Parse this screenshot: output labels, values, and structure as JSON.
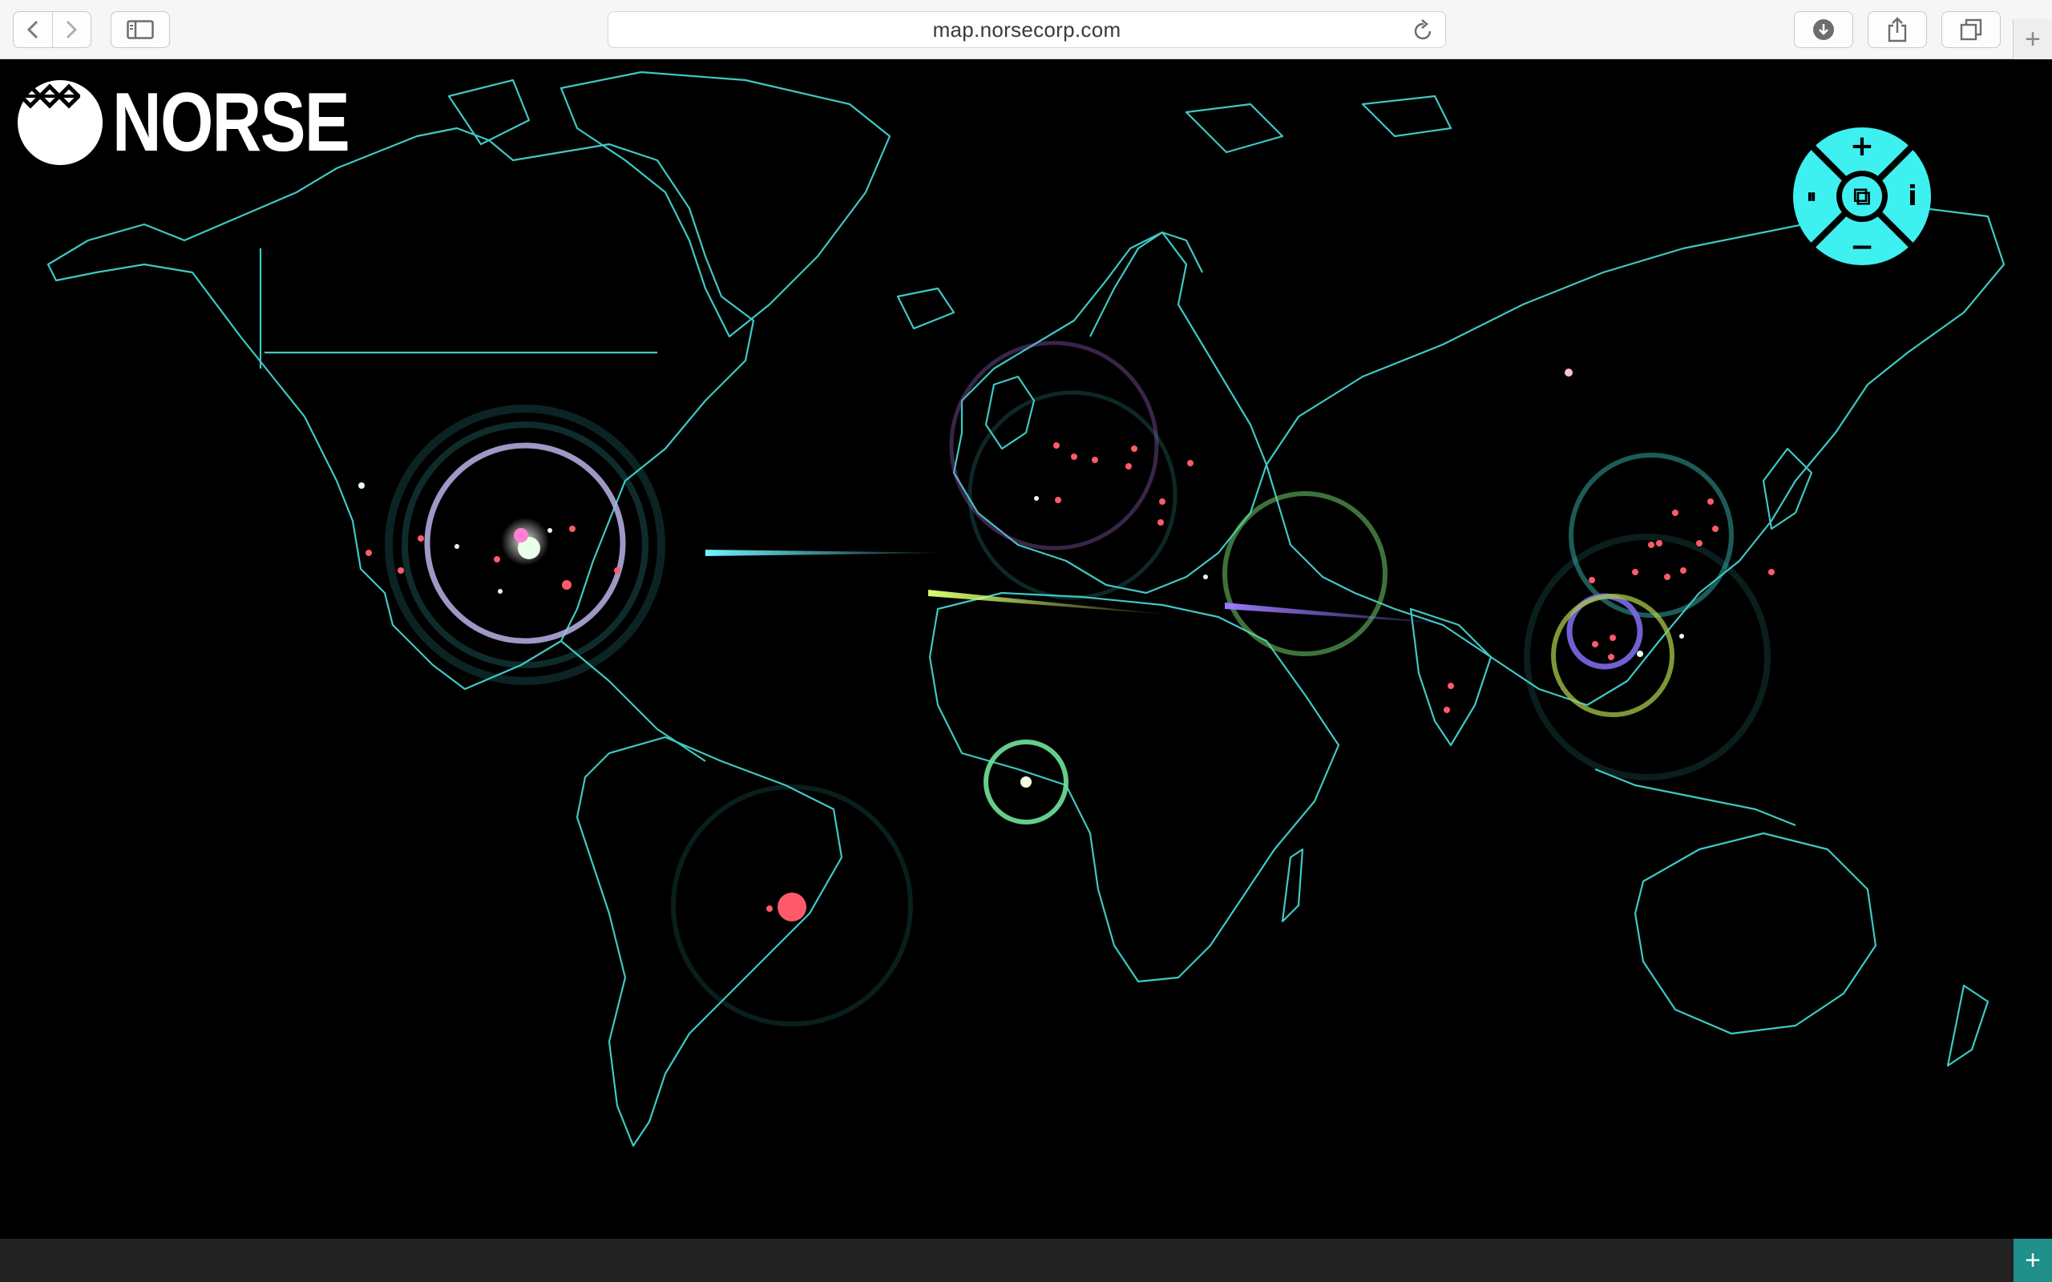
{
  "browser": {
    "url": "map.norsecorp.com",
    "icons": {
      "back": "chevron-left-icon",
      "forward": "chevron-right-icon",
      "sidebar": "sidebar-icon",
      "reload": "reload-icon",
      "downloads": "download-icon",
      "share": "share-icon",
      "tabs": "tabs-overview-icon",
      "new_tab": "plus-icon"
    },
    "new_tab_label": "+"
  },
  "brand": {
    "name": "NORSE"
  },
  "controls": {
    "zoom_in": "+",
    "zoom_out": "−",
    "pause": "⏸",
    "fullscreen": "⧉",
    "info": "i"
  },
  "bottom_bar": {
    "expand_label": "+"
  },
  "colors": {
    "map_lines": "#3fc9c4",
    "accent": "#3ff0f0",
    "attack_red": "#ff5a6a",
    "background": "#000000"
  }
}
